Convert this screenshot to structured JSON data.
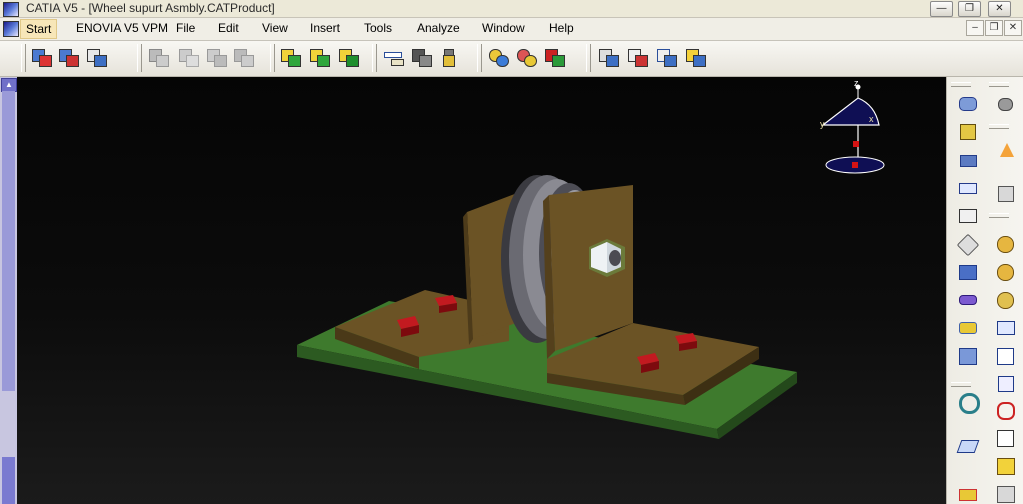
{
  "window": {
    "title": "CATIA V5 - [Wheel supurt Asmbly.CATProduct]",
    "minimize_glyph": "—",
    "maximize_glyph": "❐",
    "close_glyph": "✕"
  },
  "menu": {
    "items": [
      "Start",
      "ENOVIA V5 VPM",
      "File",
      "Edit",
      "View",
      "Insert",
      "Tools",
      "Analyze",
      "Window",
      "Help"
    ],
    "doc_minimize_glyph": "–",
    "doc_restore_glyph": "❐",
    "doc_close_glyph": "✕"
  },
  "compass": {
    "z_label": "z",
    "x_label": "x",
    "y_label": "y"
  },
  "toolbar": {
    "icons": [
      "new-product-icon",
      "new-component-icon",
      "existing-component-icon",
      "reorder-icon",
      "fast-multi-instantiation-icon",
      "define-multi-instantiation-icon",
      "insert-assembly-icon",
      "replace-component-icon",
      "graph-tree-reorder-icon",
      "measure-between-icon",
      "measure-item-icon",
      "measure-inertia-icon",
      "clash-analysis-icon",
      "sectioning-icon",
      "distance-band-icon",
      "update-icon",
      "manipulation-icon",
      "snap-icon",
      "explode-icon",
      "smart-move-icon"
    ]
  },
  "right_toolbar": {
    "icons": [
      "constraint-icon",
      "select-arrow-icon",
      "coincidence-icon",
      "contact-icon",
      "offset-icon",
      "angle-icon",
      "fix-icon",
      "fix-together-icon",
      "quick-constraint-icon",
      "flexible-rigid-icon",
      "change-constraint-icon",
      "reuse-pattern-icon",
      "catalog-icon",
      "bill-of-material-icon"
    ]
  },
  "colors": {
    "viewport_bg": "#0b0b0b",
    "base_plate": "#3e7a2d",
    "bracket": "#6b5325",
    "wheel": "#7c7c84",
    "nut": "#d6dde0",
    "pads": "#a10e14",
    "compass": "#0f0f54"
  }
}
